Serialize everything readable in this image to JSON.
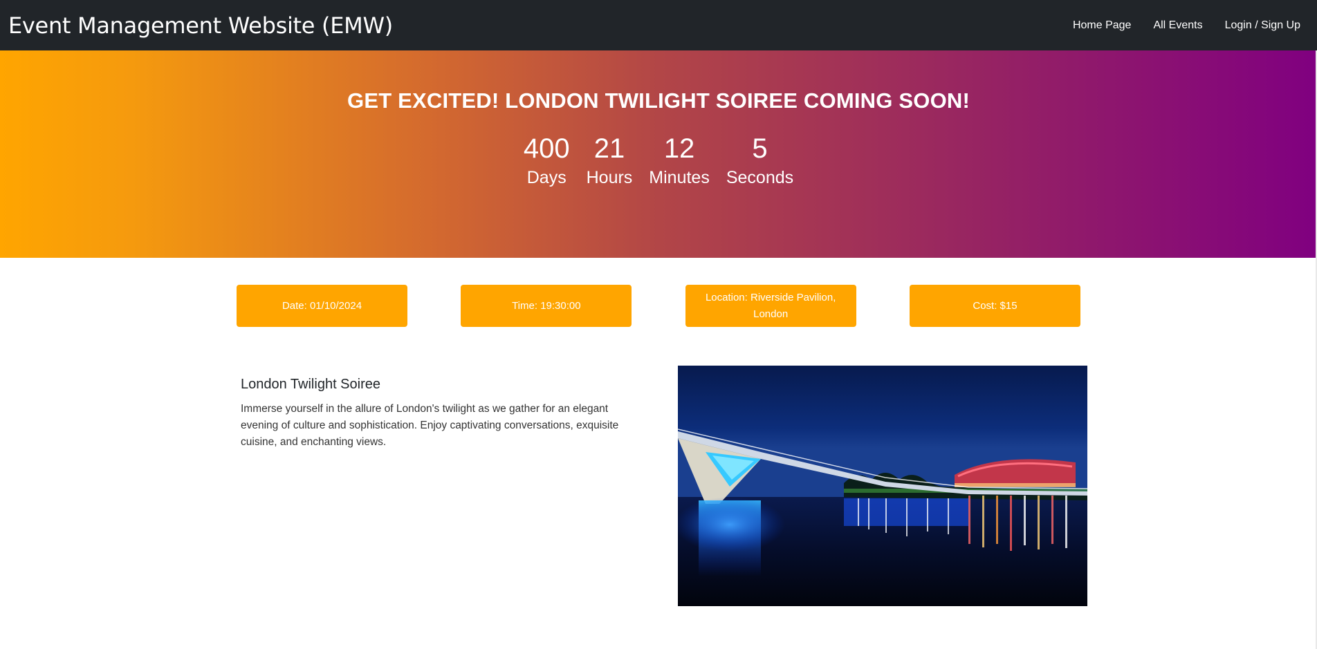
{
  "navbar": {
    "brand": "Event Management Website (EMW)",
    "links": [
      "Home Page",
      "All Events",
      "Login / Sign Up"
    ]
  },
  "hero": {
    "title": "GET EXCITED! LONDON TWILIGHT SOIREE COMING SOON!",
    "countdown": [
      {
        "value": "400",
        "label": "Days"
      },
      {
        "value": "21",
        "label": "Hours"
      },
      {
        "value": "12",
        "label": "Minutes"
      },
      {
        "value": "5",
        "label": "Seconds"
      }
    ],
    "gradient_colors": [
      "#ffa500",
      "#800080"
    ]
  },
  "info": {
    "date": "Date: 01/10/2024",
    "time": "Time: 19:30:00",
    "location": "Location: Riverside Pavilion, London",
    "cost": "Cost: $15"
  },
  "event": {
    "title": "London Twilight Soiree",
    "description": "Immerse yourself in the allure of London's twilight as we gather for an elegant evening of culture and sophistication. Enjoy captivating conversations, exquisite cuisine, and enchanting views."
  },
  "colors": {
    "navbar_bg": "#212529",
    "accent": "#ffa500"
  }
}
